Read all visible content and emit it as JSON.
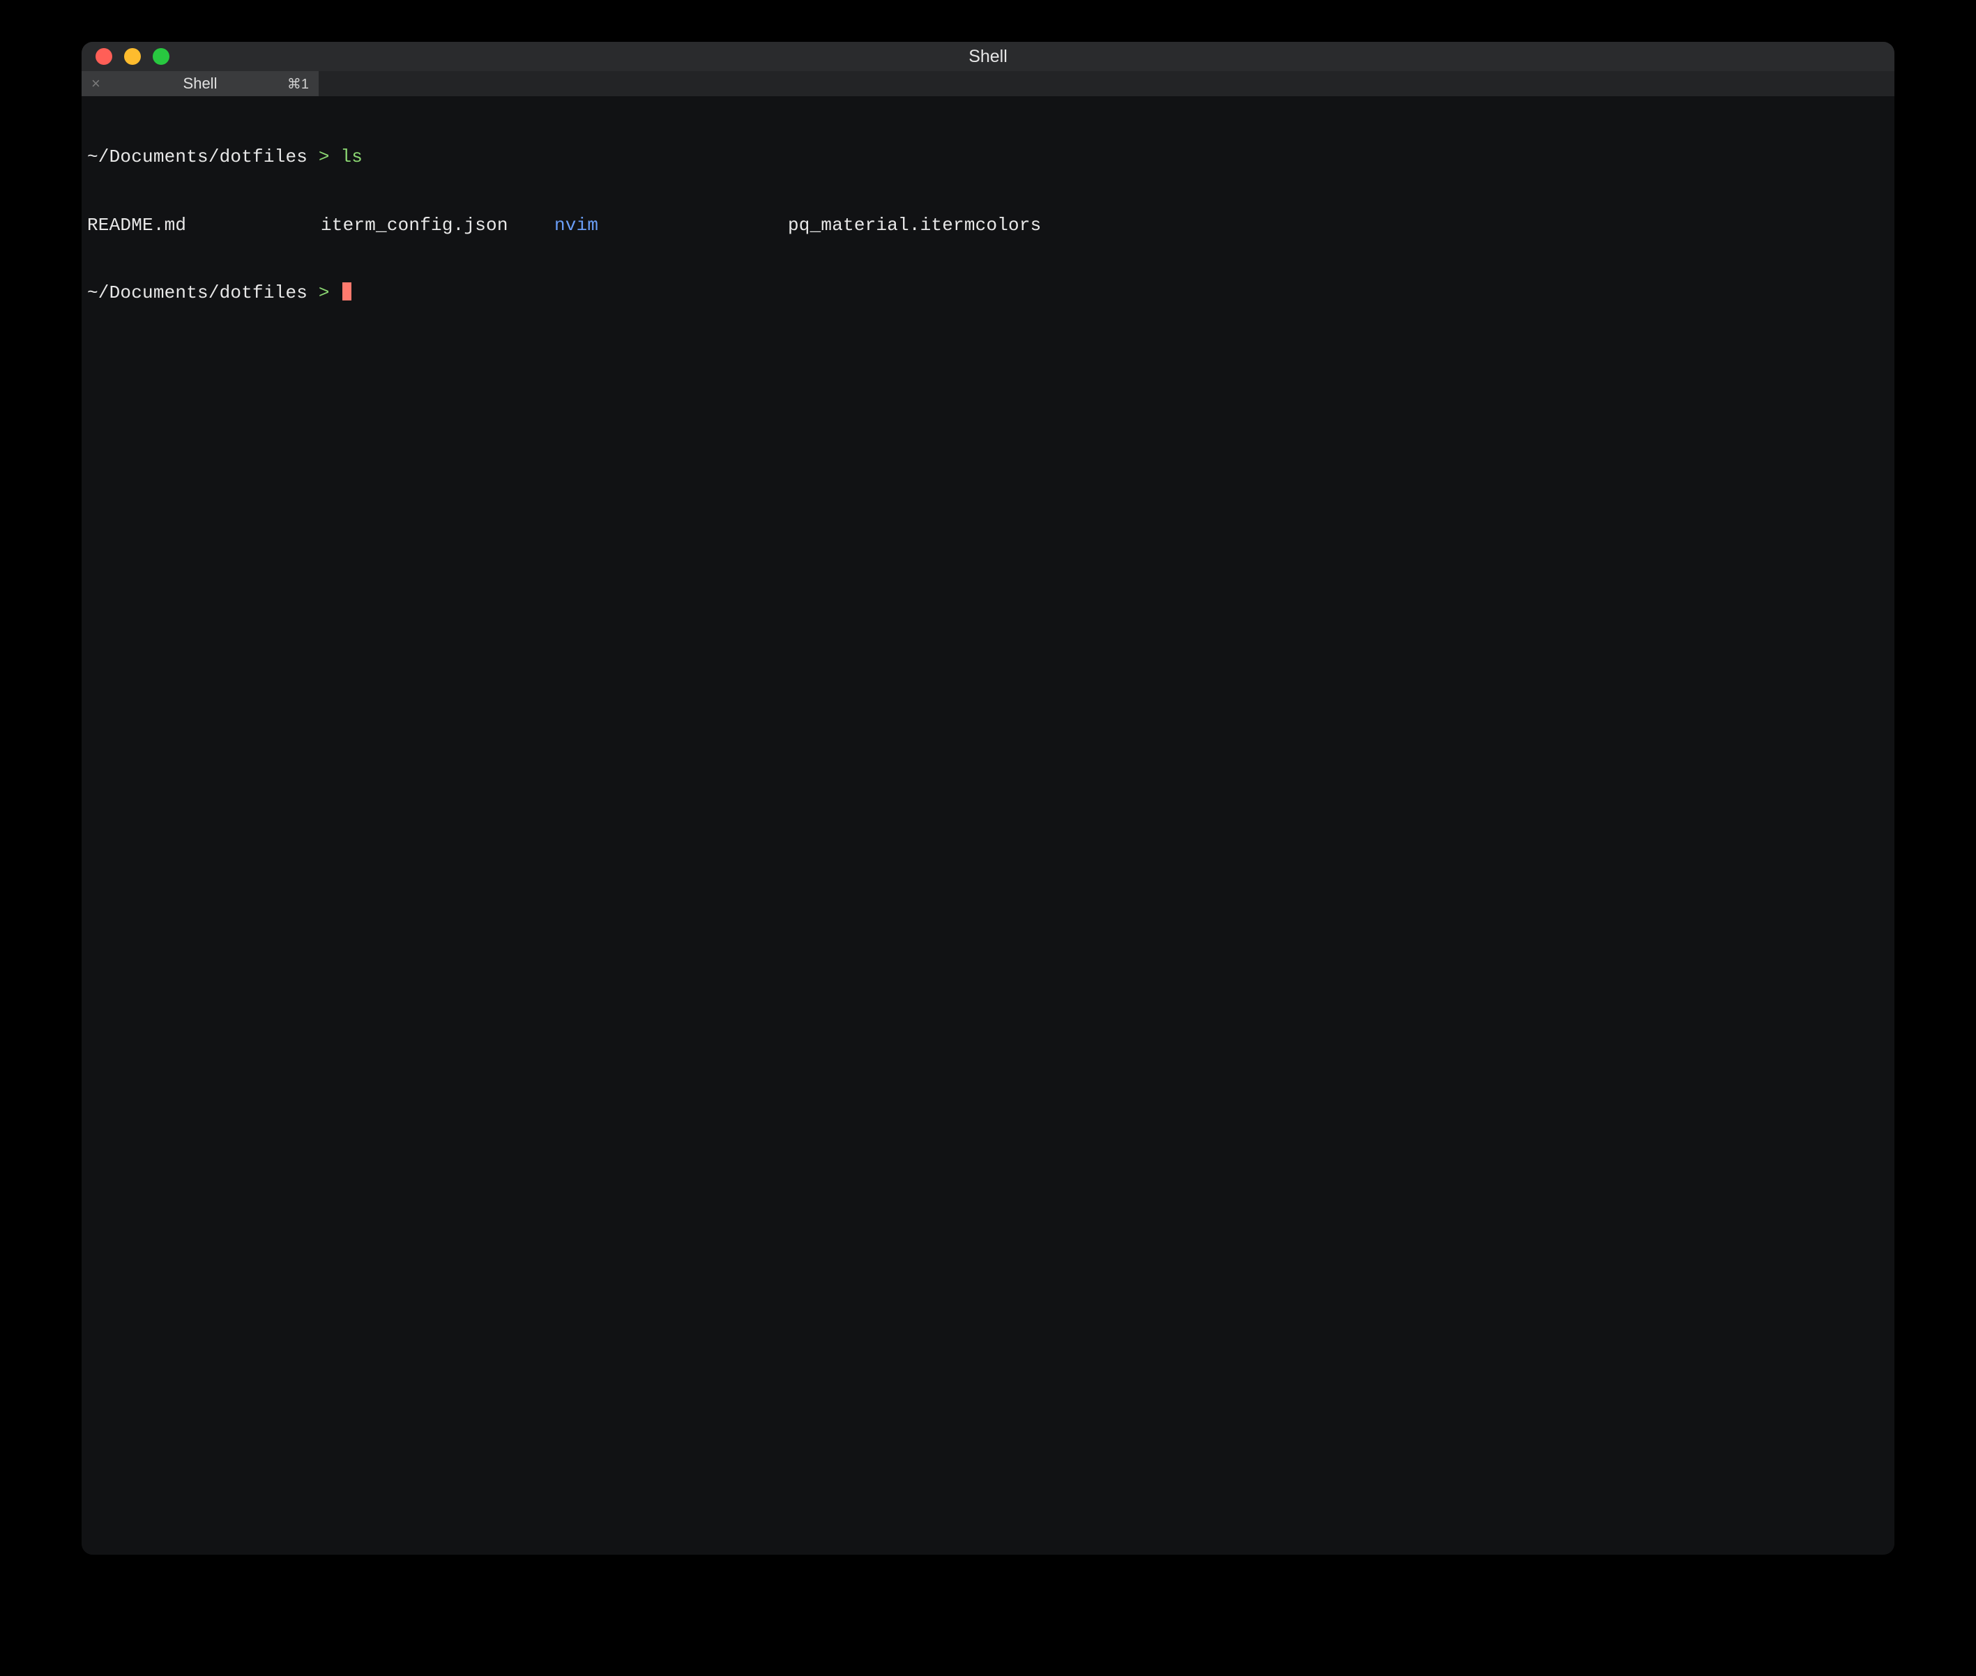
{
  "window": {
    "title": "Shell"
  },
  "tab": {
    "close_glyph": "×",
    "label": "Shell",
    "shortcut": "⌘1"
  },
  "terminal": {
    "line1": {
      "path": "~/Documents/dotfiles",
      "sym": ">",
      "cmd": "ls"
    },
    "ls": {
      "c1": "README.md",
      "c2": "iterm_config.json",
      "c3": "nvim",
      "c4": "pq_material.itermcolors"
    },
    "line3": {
      "path": "~/Documents/dotfiles",
      "sym": ">"
    }
  },
  "colors": {
    "bg": "#111214",
    "fg": "#e8e8e8",
    "green": "#8bd672",
    "blue": "#6a9ef8",
    "cursor": "#ff7a6e",
    "traffic_red": "#ff5f57",
    "traffic_yellow": "#febc2e",
    "traffic_green": "#28c840"
  }
}
